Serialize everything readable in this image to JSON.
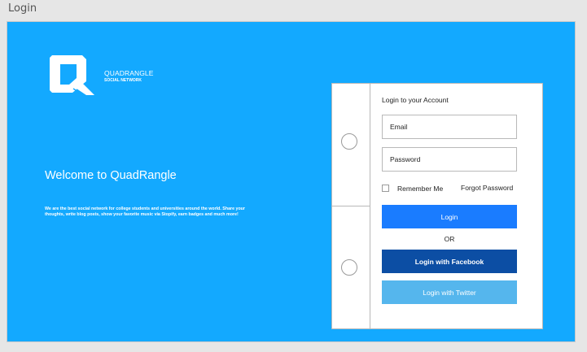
{
  "window": {
    "title": "Login"
  },
  "brand": {
    "name": "QUADRANGLE",
    "tagline": "SOCIAL NETWORK",
    "logo_icon": "quadrangle-q-logo"
  },
  "hero": {
    "welcome": "Welcome to QuadRangle",
    "description": "We are the best social network for college students and universities around the world. Share your thoughts, write blog posts, show your favorite music via Stopify, earn badges and much more!"
  },
  "form": {
    "title": "Login to your Account",
    "email_placeholder": "Email",
    "password_placeholder": "Password",
    "remember_label": "Remember Me",
    "forgot_label": "Forgot Password",
    "login_label": "Login",
    "or_label": "OR",
    "facebook_label": "Login with Facebook",
    "twitter_label": "Login with Twitter"
  },
  "colors": {
    "background": "#13a9ff",
    "login_button": "#1a7cff",
    "facebook_button": "#0c4ea4",
    "twitter_button": "#55b6ed"
  }
}
